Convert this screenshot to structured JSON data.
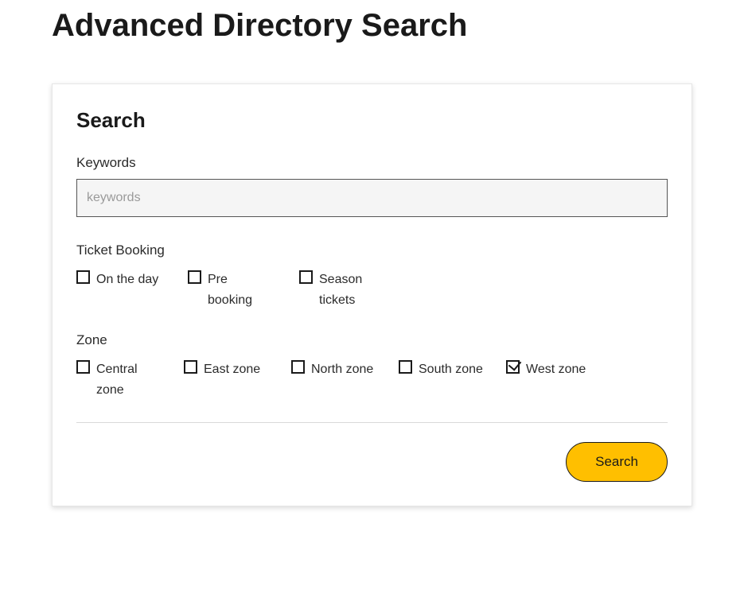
{
  "page": {
    "title": "Advanced Directory Search"
  },
  "search": {
    "heading": "Search",
    "keywords": {
      "label": "Keywords",
      "placeholder": "keywords",
      "value": ""
    },
    "ticket_booking": {
      "label": "Ticket Booking",
      "options": [
        {
          "label": "On the day",
          "checked": false
        },
        {
          "label": "Pre booking",
          "checked": false
        },
        {
          "label": "Season tickets",
          "checked": false
        }
      ]
    },
    "zone": {
      "label": "Zone",
      "options": [
        {
          "label": "Central zone",
          "checked": false
        },
        {
          "label": "East zone",
          "checked": false
        },
        {
          "label": "North zone",
          "checked": false
        },
        {
          "label": "South zone",
          "checked": false
        },
        {
          "label": "West zone",
          "checked": true
        }
      ]
    },
    "submit_label": "Search"
  },
  "colors": {
    "accent": "#ffbf00"
  }
}
